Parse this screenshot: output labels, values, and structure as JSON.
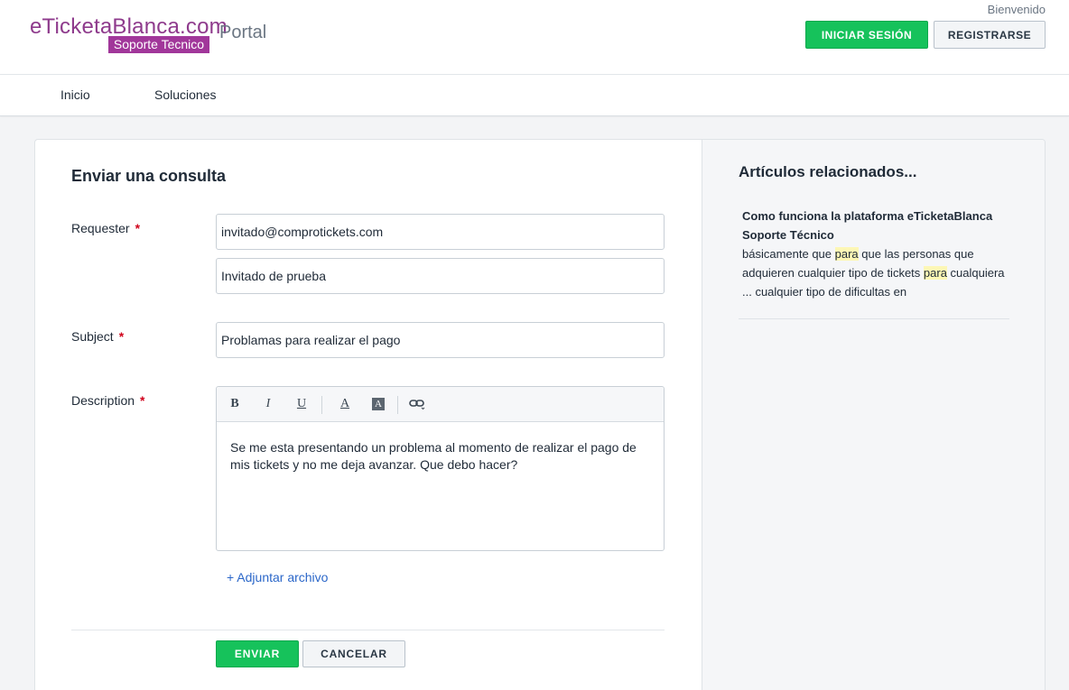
{
  "header": {
    "logo_text": "eTicketaBlanca.com",
    "logo_badge": "Soporte Tecnico",
    "portal_label": "Portal",
    "welcome": "Bienvenido",
    "login_label": "INICIAR SESIÓN",
    "register_label": "REGISTRARSE"
  },
  "nav": {
    "items": [
      {
        "label": "Inicio"
      },
      {
        "label": "Soluciones"
      }
    ]
  },
  "form": {
    "title": "Enviar una consulta",
    "requester_label": "Requester",
    "requester_email": "invitado@comprotickets.com",
    "requester_name": "Invitado de prueba",
    "subject_label": "Subject",
    "subject_value": "Problamas para realizar el pago",
    "description_label": "Description",
    "description_text": "Se me esta presentando un problema al momento de realizar el pago de mis tickets y no me deja avanzar. Que debo hacer?",
    "required_mark": "*",
    "toolbar": {
      "bold": "B",
      "italic": "I",
      "underline": "U",
      "font_color": "A",
      "bg_color": "A"
    },
    "attach_label": "+ Adjuntar archivo",
    "submit_label": "ENVIAR",
    "cancel_label": "CANCELAR"
  },
  "sidebar": {
    "title": "Artículos relacionados...",
    "article": {
      "title": "Como funciona la plataforma eTicketaBlanca Soporte Técnico",
      "snippet_1": "básicamente que ",
      "highlight_1": "para",
      "snippet_2": " que las personas que adquieren cualquier tipo de tickets ",
      "highlight_2": "para",
      "snippet_3": " cualquiera ... cualquier tipo de dificultas en"
    }
  },
  "colors": {
    "brand_purple": "#a1379a",
    "primary_green": "#16c25b",
    "link_blue": "#2b67c9",
    "required_red": "#d0021b",
    "highlight_yellow": "#fdf7b5"
  }
}
